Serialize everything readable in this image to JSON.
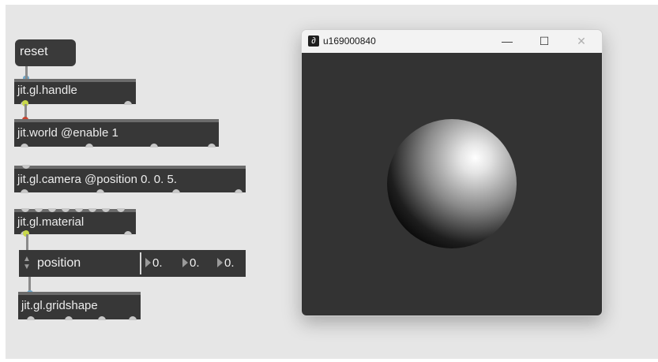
{
  "patcher": {
    "reset_message": "reset",
    "objects": {
      "handle": "jit.gl.handle",
      "world": "jit.world @enable 1",
      "camera": "jit.gl.camera @position 0. 0. 5.",
      "material": "jit.gl.material",
      "gridshape": "jit.gl.gridshape"
    },
    "param": {
      "label": "position",
      "values": [
        "0.",
        "0.",
        "0."
      ]
    }
  },
  "window": {
    "title": "u169000840",
    "minimize": "—",
    "maximize": "☐",
    "close": "✕"
  },
  "colors": {
    "object_bg": "#373737",
    "patcher_bg": "#e6e6e6",
    "viewport_bg": "#333333"
  }
}
